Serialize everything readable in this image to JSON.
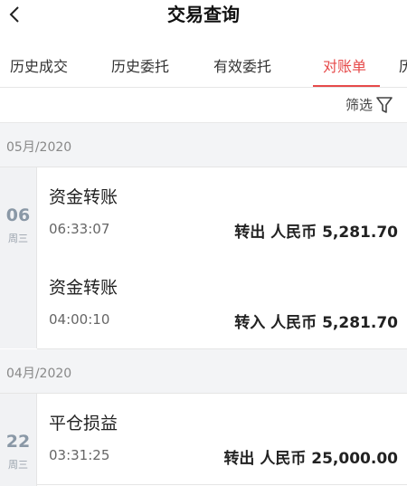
{
  "header": {
    "title": "交易查询",
    "back_icon": "chevron-left-icon"
  },
  "tabs": [
    {
      "label": "历史成交",
      "active": false
    },
    {
      "label": "历史委托",
      "active": false
    },
    {
      "label": "有效委托",
      "active": false
    },
    {
      "label": "对账单",
      "active": true
    },
    {
      "label": "历",
      "active": false
    }
  ],
  "filter": {
    "label": "筛选",
    "icon": "filter-funnel-icon"
  },
  "colors": {
    "accent": "#e64a4a",
    "day_text": "#8a98a6",
    "section_bg": "#f3f4f6"
  },
  "groups": [
    {
      "month": "05月/2020",
      "days": [
        {
          "day": "06",
          "weekday": "周三",
          "records": [
            {
              "name": "资金转账",
              "time": "06:33:07",
              "amount": "转出 人民币 5,281.70"
            },
            {
              "name": "资金转账",
              "time": "04:00:10",
              "amount": "转入 人民币 5,281.70"
            }
          ]
        }
      ]
    },
    {
      "month": "04月/2020",
      "days": [
        {
          "day": "22",
          "weekday": "周三",
          "records": [
            {
              "name": "平仓损益",
              "time": "03:31:25",
              "amount": "转出 人民币 25,000.00"
            }
          ]
        }
      ]
    }
  ]
}
